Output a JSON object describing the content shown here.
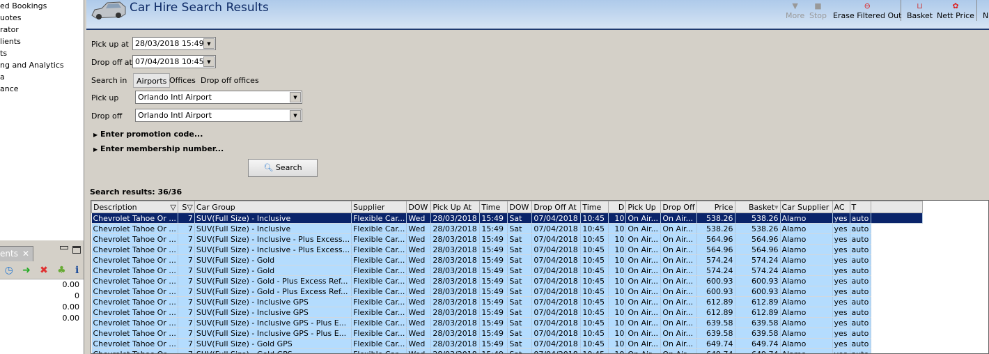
{
  "sidebar": {
    "items": [
      "ed Bookings",
      "uotes",
      "rator",
      "lients",
      "ts",
      "ng and Analytics",
      "a",
      "ance"
    ]
  },
  "panel": {
    "tab_label": "ents",
    "values": [
      "0.00",
      "0",
      "0.00",
      "0.00"
    ]
  },
  "header": {
    "title": "Car Hire Search Results",
    "toolbar": [
      {
        "label": "More",
        "icon": "triangle-down-icon",
        "enabled": false
      },
      {
        "label": "Stop",
        "icon": "stop-icon",
        "enabled": false
      },
      {
        "label": "Erase Filtered Out",
        "icon": "erase-icon",
        "enabled": true
      },
      {
        "label": "Basket",
        "icon": "basket-icon",
        "enabled": true
      },
      {
        "label": "Nett Price",
        "icon": "nett-price-icon",
        "enabled": true
      },
      {
        "label": "N",
        "icon": "",
        "enabled": true
      }
    ]
  },
  "form": {
    "pickup_at_label": "Pick up at",
    "pickup_at": "28/03/2018 15:49",
    "dropoff_at_label": "Drop off at",
    "dropoff_at": "07/04/2018 10:45",
    "search_in_label": "Search in",
    "search_in_options": [
      "Airports",
      "Offices",
      "Drop off offices"
    ],
    "pickup_label": "Pick up",
    "pickup": "Orlando Intl Airport",
    "dropoff_label": "Drop off",
    "dropoff": "Orlando Intl Airport",
    "promo": "Enter promotion code...",
    "membership": "Enter membership number...",
    "search_button": "Search"
  },
  "results": {
    "label": "Search results: 36/36",
    "columns": [
      "Description",
      "S",
      "Car Group",
      "Supplier",
      "DOW",
      "Pick Up At",
      "Time",
      "DOW",
      "Drop Off At",
      "Time",
      "D",
      "Pick Up",
      "Drop Off",
      "Price",
      "Basket",
      "Car Supplier",
      "AC",
      "T"
    ],
    "rows": [
      [
        "Chevrolet Tahoe Or ...",
        "7",
        "SUV(Full Size) - Inclusive",
        "Flexible Car...",
        "Wed",
        "28/03/2018",
        "15:49",
        "Sat",
        "07/04/2018",
        "10:45",
        "10",
        "On Air...",
        "On Air...",
        "538.26",
        "538.26",
        "Alamo",
        "yes",
        "auto"
      ],
      [
        "Chevrolet Tahoe Or ...",
        "7",
        "SUV(Full Size) - Inclusive",
        "Flexible Car...",
        "Wed",
        "28/03/2018",
        "15:49",
        "Sat",
        "07/04/2018",
        "10:45",
        "10",
        "On Air...",
        "On Air...",
        "538.26",
        "538.26",
        "Alamo",
        "yes",
        "auto"
      ],
      [
        "Chevrolet Tahoe Or ...",
        "7",
        "SUV(Full Size) - Inclusive - Plus Excess...",
        "Flexible Car...",
        "Wed",
        "28/03/2018",
        "15:49",
        "Sat",
        "07/04/2018",
        "10:45",
        "10",
        "On Air...",
        "On Air...",
        "564.96",
        "564.96",
        "Alamo",
        "yes",
        "auto"
      ],
      [
        "Chevrolet Tahoe Or ...",
        "7",
        "SUV(Full Size) - Inclusive - Plus Excess...",
        "Flexible Car...",
        "Wed",
        "28/03/2018",
        "15:49",
        "Sat",
        "07/04/2018",
        "10:45",
        "10",
        "On Air...",
        "On Air...",
        "564.96",
        "564.96",
        "Alamo",
        "yes",
        "auto"
      ],
      [
        "Chevrolet Tahoe Or ...",
        "7",
        "SUV(Full Size) - Gold",
        "Flexible Car...",
        "Wed",
        "28/03/2018",
        "15:49",
        "Sat",
        "07/04/2018",
        "10:45",
        "10",
        "On Air...",
        "On Air...",
        "574.24",
        "574.24",
        "Alamo",
        "yes",
        "auto"
      ],
      [
        "Chevrolet Tahoe Or ...",
        "7",
        "SUV(Full Size) - Gold",
        "Flexible Car...",
        "Wed",
        "28/03/2018",
        "15:49",
        "Sat",
        "07/04/2018",
        "10:45",
        "10",
        "On Air...",
        "On Air...",
        "574.24",
        "574.24",
        "Alamo",
        "yes",
        "auto"
      ],
      [
        "Chevrolet Tahoe Or ...",
        "7",
        "SUV(Full Size) - Gold - Plus Excess Ref...",
        "Flexible Car...",
        "Wed",
        "28/03/2018",
        "15:49",
        "Sat",
        "07/04/2018",
        "10:45",
        "10",
        "On Air...",
        "On Air...",
        "600.93",
        "600.93",
        "Alamo",
        "yes",
        "auto"
      ],
      [
        "Chevrolet Tahoe Or ...",
        "7",
        "SUV(Full Size) - Gold - Plus Excess Ref...",
        "Flexible Car...",
        "Wed",
        "28/03/2018",
        "15:49",
        "Sat",
        "07/04/2018",
        "10:45",
        "10",
        "On Air...",
        "On Air...",
        "600.93",
        "600.93",
        "Alamo",
        "yes",
        "auto"
      ],
      [
        "Chevrolet Tahoe Or ...",
        "7",
        "SUV(Full Size) - Inclusive GPS",
        "Flexible Car...",
        "Wed",
        "28/03/2018",
        "15:49",
        "Sat",
        "07/04/2018",
        "10:45",
        "10",
        "On Air...",
        "On Air...",
        "612.89",
        "612.89",
        "Alamo",
        "yes",
        "auto"
      ],
      [
        "Chevrolet Tahoe Or ...",
        "7",
        "SUV(Full Size) - Inclusive GPS",
        "Flexible Car...",
        "Wed",
        "28/03/2018",
        "15:49",
        "Sat",
        "07/04/2018",
        "10:45",
        "10",
        "On Air...",
        "On Air...",
        "612.89",
        "612.89",
        "Alamo",
        "yes",
        "auto"
      ],
      [
        "Chevrolet Tahoe Or ...",
        "7",
        "SUV(Full Size) - Inclusive GPS - Plus E...",
        "Flexible Car...",
        "Wed",
        "28/03/2018",
        "15:49",
        "Sat",
        "07/04/2018",
        "10:45",
        "10",
        "On Air...",
        "On Air...",
        "639.58",
        "639.58",
        "Alamo",
        "yes",
        "auto"
      ],
      [
        "Chevrolet Tahoe Or ...",
        "7",
        "SUV(Full Size) - Inclusive GPS - Plus E...",
        "Flexible Car...",
        "Wed",
        "28/03/2018",
        "15:49",
        "Sat",
        "07/04/2018",
        "10:45",
        "10",
        "On Air...",
        "On Air...",
        "639.58",
        "639.58",
        "Alamo",
        "yes",
        "auto"
      ],
      [
        "Chevrolet Tahoe Or ...",
        "7",
        "SUV(Full Size) - Gold GPS",
        "Flexible Car...",
        "Wed",
        "28/03/2018",
        "15:49",
        "Sat",
        "07/04/2018",
        "10:45",
        "10",
        "On Air...",
        "On Air...",
        "649.74",
        "649.74",
        "Alamo",
        "yes",
        "auto"
      ],
      [
        "Chevrolet Tahoe Or ...",
        "7",
        "SUV(Full Size) - Gold GPS",
        "Flexible Car...",
        "Wed",
        "28/03/2018",
        "15:49",
        "Sat",
        "07/04/2018",
        "10:45",
        "10",
        "On Air...",
        "On Air...",
        "649.74",
        "649.74",
        "Alamo",
        "yes",
        "auto"
      ]
    ],
    "selected_row": 0
  }
}
